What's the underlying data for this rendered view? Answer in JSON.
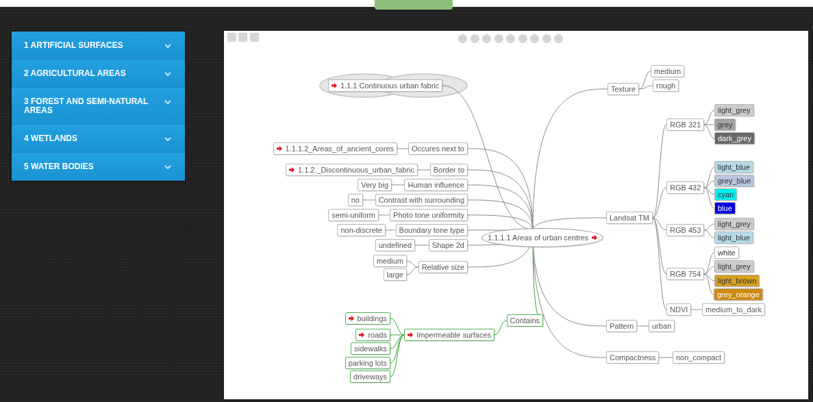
{
  "sidebar": {
    "items": [
      {
        "label": "1 ARTIFICIAL SURFACES",
        "expanded": false
      },
      {
        "label": "2 AGRICULTURAL AREAS",
        "expanded": false
      },
      {
        "label": "3 FOREST AND SEMI-NATURAL AREAS",
        "expanded": false
      },
      {
        "label": "4 WETLANDS",
        "expanded": false
      },
      {
        "label": "5 WATER BODIES",
        "expanded": false
      }
    ]
  },
  "mindmap": {
    "parent": {
      "label": "1.1.1 Continuous urban fabric",
      "link": true
    },
    "central": {
      "label": "1.1.1.1 Areas of urban centres",
      "link": true
    },
    "left": [
      {
        "label": "Occures next to",
        "link": false,
        "highlighted": false,
        "children": [
          {
            "label": "1.1.1.2_Areas_of_ancient_cores",
            "link": true
          }
        ]
      },
      {
        "label": "Border to",
        "link": false,
        "highlighted": false,
        "children": [
          {
            "label": "1.1.2._Discontinuous_urban_fabric",
            "link": true
          }
        ]
      },
      {
        "label": "Human influence",
        "link": false,
        "highlighted": false,
        "children": [
          {
            "label": "Very big",
            "link": false
          }
        ]
      },
      {
        "label": "Contrast with surrounding",
        "link": false,
        "highlighted": false,
        "children": [
          {
            "label": "no",
            "link": false
          }
        ]
      },
      {
        "label": "Photo tone uniformity",
        "link": false,
        "highlighted": false,
        "children": [
          {
            "label": "semi-uniform",
            "link": false
          }
        ]
      },
      {
        "label": "Boundary tone type",
        "link": false,
        "highlighted": false,
        "children": [
          {
            "label": "non-discrete",
            "link": false
          }
        ]
      },
      {
        "label": "Shape 2d",
        "link": false,
        "highlighted": false,
        "children": [
          {
            "label": "undefined",
            "link": false
          }
        ]
      },
      {
        "label": "Relative size",
        "link": false,
        "highlighted": false,
        "children": [
          {
            "label": "medium",
            "link": false
          },
          {
            "label": "large",
            "link": false
          }
        ]
      },
      {
        "label": "Contains",
        "link": false,
        "highlighted": true,
        "children": [
          {
            "label": "Impermeable surfaces",
            "link": true,
            "children": [
              {
                "label": "buildings",
                "link": true
              },
              {
                "label": "roads",
                "link": true
              },
              {
                "label": "sidewalks",
                "link": false
              },
              {
                "label": "parking lots",
                "link": false
              },
              {
                "label": "driveways",
                "link": false
              }
            ]
          }
        ]
      }
    ],
    "right": [
      {
        "label": "Texture",
        "link": false,
        "children": [
          {
            "label": "medium",
            "link": false
          },
          {
            "label": "rough",
            "link": false
          }
        ]
      },
      {
        "label": "Landsat TM",
        "link": false,
        "children": [
          {
            "label": "RGB 321",
            "link": false,
            "children": [
              {
                "label": "light_grey",
                "link": false,
                "color": "#cccccc"
              },
              {
                "label": "grey",
                "link": false,
                "color": "#a3a3a3"
              },
              {
                "label": "dark_grey",
                "link": false,
                "color": "#686868"
              }
            ]
          },
          {
            "label": "RGB 432",
            "link": false,
            "children": [
              {
                "label": "light_blue",
                "link": false,
                "color": "#b5d8e6"
              },
              {
                "label": "grey_blue",
                "link": false,
                "color": "#b8c6dc"
              },
              {
                "label": "cyan",
                "link": false,
                "color": "#00eeee"
              },
              {
                "label": "blue",
                "link": false,
                "color": "#0000e0"
              }
            ]
          },
          {
            "label": "RGB 453",
            "link": false,
            "children": [
              {
                "label": "light_grey",
                "link": false,
                "color": "#cccccc"
              },
              {
                "label": "light_blue",
                "link": false,
                "color": "#b5dbe9"
              }
            ]
          },
          {
            "label": "RGB 754",
            "link": false,
            "children": [
              {
                "label": "white",
                "link": false,
                "color": "#ffffff"
              },
              {
                "label": "light_grey",
                "link": false,
                "color": "#cccccc"
              },
              {
                "label": "light_brown",
                "link": false,
                "color": "#d6a020"
              },
              {
                "label": "grey_orange",
                "link": false,
                "color": "#cf8a12"
              }
            ]
          },
          {
            "label": "NDVI",
            "link": false,
            "children": [
              {
                "label": "medium_to_dark",
                "link": false
              }
            ]
          }
        ]
      },
      {
        "label": "Pattern",
        "link": false,
        "children": [
          {
            "label": "urban",
            "link": false
          }
        ]
      },
      {
        "label": "Compactness",
        "link": false,
        "children": [
          {
            "label": "non_compact",
            "link": false
          }
        ]
      }
    ]
  }
}
